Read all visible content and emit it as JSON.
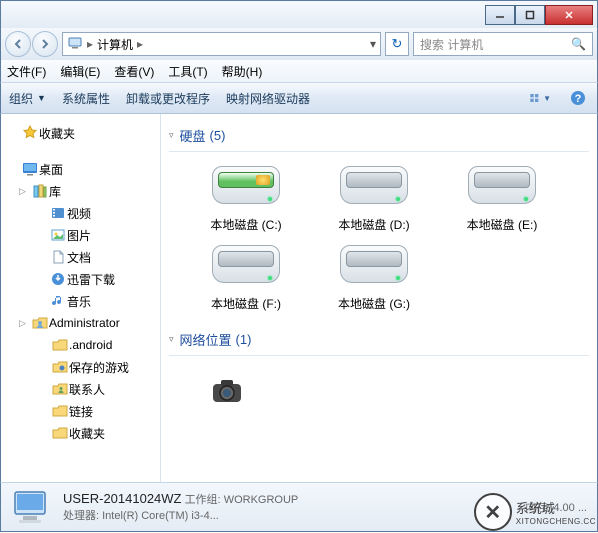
{
  "address": {
    "root": "计算机"
  },
  "search": {
    "placeholder": "搜索 计算机"
  },
  "menus": {
    "file": "文件(F)",
    "edit": "编辑(E)",
    "view": "查看(V)",
    "tools": "工具(T)",
    "help": "帮助(H)"
  },
  "toolbar": {
    "organize": "组织",
    "properties": "系统属性",
    "uninstall": "卸载或更改程序",
    "mapdrive": "映射网络驱动器"
  },
  "sidebar": {
    "favorites": "收藏夹",
    "desktop": "桌面",
    "libraries": "库",
    "videos": "视频",
    "pictures": "图片",
    "documents": "文档",
    "downloads": "迅雷下载",
    "music": "音乐",
    "admin": "Administrator",
    "android": ".android",
    "savedgames": "保存的游戏",
    "contacts": "联系人",
    "links": "链接",
    "favorites2": "收藏夹"
  },
  "groups": {
    "hdd": {
      "label": "硬盘",
      "count": "(5)"
    },
    "net": {
      "label": "网络位置",
      "count": "(1)"
    }
  },
  "drives": {
    "c": "本地磁盘 (C:)",
    "d": "本地磁盘 (D:)",
    "e": "本地磁盘 (E:)",
    "f": "本地磁盘 (F:)",
    "g": "本地磁盘 (G:)"
  },
  "status": {
    "pcname": "USER-20141024WZ",
    "workgroup_label": "工作组:",
    "workgroup": "WORKGROUP",
    "cpu_label": "处理器:",
    "cpu": "Intel(R) Core(TM) i3-4...",
    "mem_label": "内存:",
    "mem": "4.00 ..."
  },
  "watermark": {
    "brand": "系统城",
    "url": "XITONGCHENG.CC"
  }
}
